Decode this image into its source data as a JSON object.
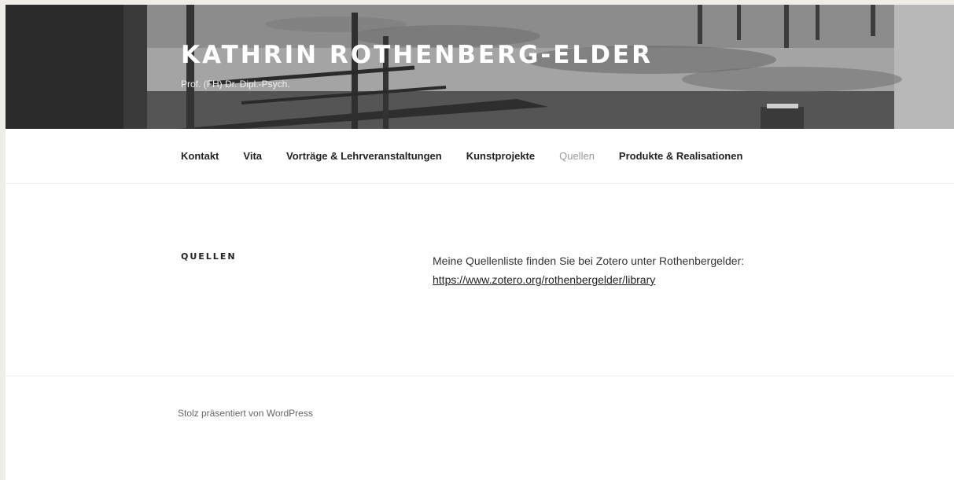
{
  "header": {
    "site_title": "KATHRIN ROTHENBERG-ELDER",
    "site_description": "Prof. (FH) Dr. Dipl.-Psych."
  },
  "nav": {
    "items": [
      {
        "label": "Kontakt",
        "current": false
      },
      {
        "label": "Vita",
        "current": false
      },
      {
        "label": "Vorträge & Lehrveranstaltungen",
        "current": false
      },
      {
        "label": "Kunstprojekte",
        "current": false
      },
      {
        "label": "Quellen",
        "current": true
      },
      {
        "label": "Produkte & Realisationen",
        "current": false
      }
    ]
  },
  "main": {
    "title": "QUELLEN",
    "text": "Meine Quellenliste finden Sie bei Zotero unter Rothenbergelder:",
    "link": "https://www.zotero.org/rothenbergelder/library"
  },
  "footer": {
    "credit": "Stolz präsentiert von WordPress"
  }
}
